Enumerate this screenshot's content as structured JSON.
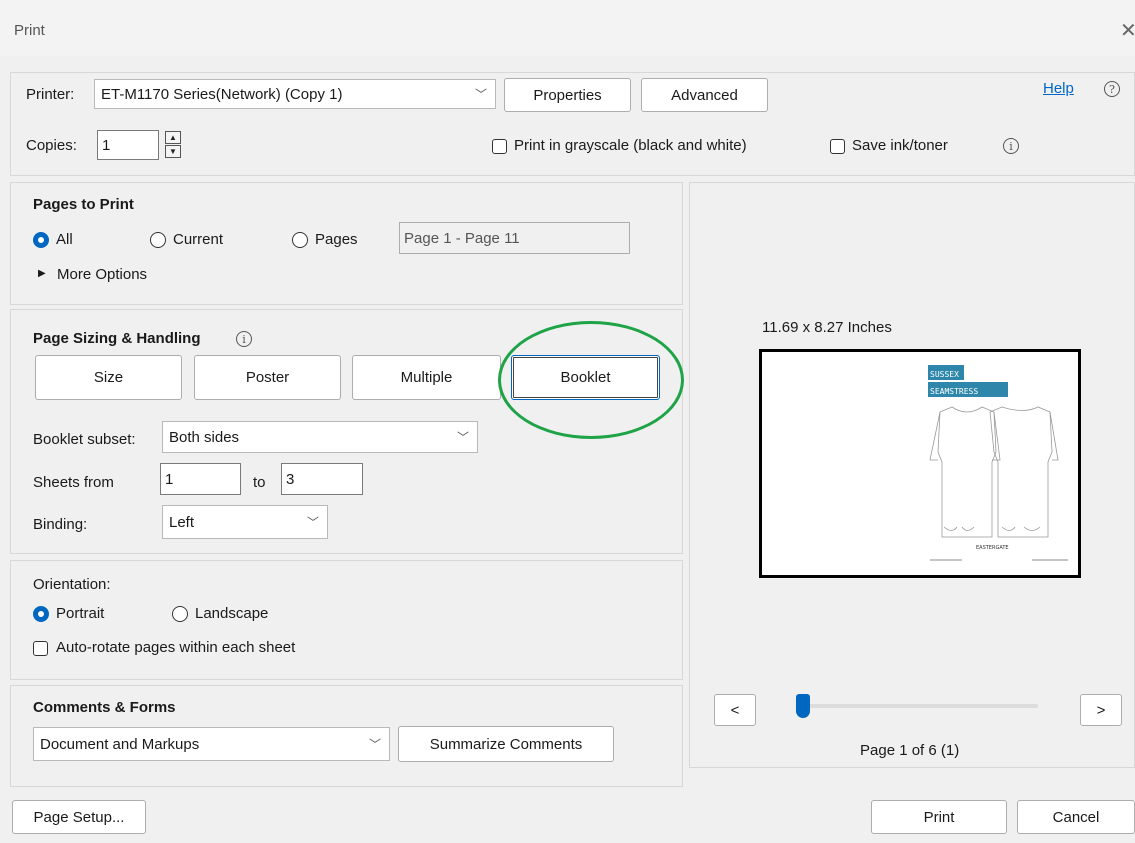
{
  "window": {
    "title": "Print",
    "close_glyph": "✕"
  },
  "printer": {
    "label": "Printer:",
    "selected": "ET-M1170 Series(Network) (Copy 1)",
    "properties_label": "Properties",
    "advanced_label": "Advanced",
    "help_label": "Help",
    "help_icon": "?"
  },
  "copies": {
    "label": "Copies:",
    "value": "1",
    "grayscale_label": "Print in grayscale (black and white)",
    "save_ink_label": "Save ink/toner",
    "info_icon": "i"
  },
  "pages_to_print": {
    "heading": "Pages to Print",
    "all_label": "All",
    "current_label": "Current",
    "pages_label": "Pages",
    "range_value": "Page 1 - Page 11",
    "more_options_label": "More Options",
    "more_options_icon": "▶"
  },
  "sizing": {
    "heading": "Page Sizing & Handling",
    "info_icon": "i",
    "size_label": "Size",
    "poster_label": "Poster",
    "multiple_label": "Multiple",
    "booklet_label": "Booklet",
    "booklet_subset_label": "Booklet subset:",
    "booklet_subset_value": "Both sides",
    "sheets_from_label": "Sheets from",
    "sheets_from_value": "1",
    "sheets_to_label": "to",
    "sheets_to_value": "3",
    "binding_label": "Binding:",
    "binding_value": "Left"
  },
  "orientation": {
    "heading": "Orientation:",
    "portrait_label": "Portrait",
    "landscape_label": "Landscape",
    "autorotate_label": "Auto-rotate pages within each sheet"
  },
  "comments": {
    "heading": "Comments & Forms",
    "value": "Document and Markups",
    "summarize_label": "Summarize Comments"
  },
  "preview": {
    "size_text": "11.69 x 8.27 Inches",
    "doc_title_line1": "SUSSEX",
    "doc_title_line2": "SEAMSTRESS",
    "doc_caption": "EASTERGATE",
    "prev_label": "<",
    "next_label": ">",
    "page_indicator": "Page 1 of 6 (1)",
    "slider_position": 0
  },
  "footer": {
    "page_setup_label": "Page Setup...",
    "print_label": "Print",
    "cancel_label": "Cancel"
  },
  "colors": {
    "accent": "#0067c0",
    "highlight": "#1fa347",
    "doc_blue": "#2e86ab"
  }
}
